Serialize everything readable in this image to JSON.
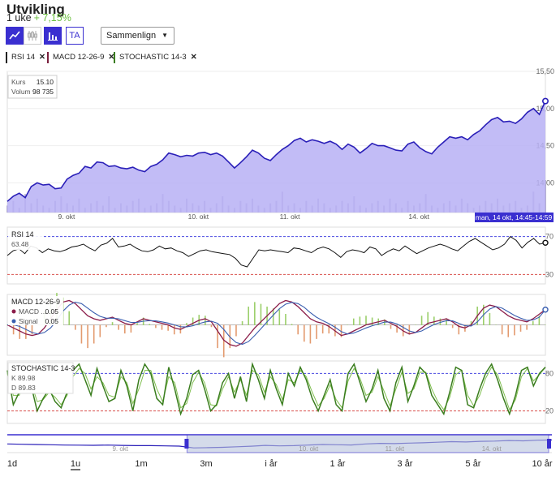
{
  "header": {
    "title": "Utvikling",
    "period": "1 uke",
    "change": "+ 7,15%"
  },
  "toolbar": {
    "buttons": [
      {
        "icon": "line-chart-icon",
        "active": true
      },
      {
        "icon": "candlestick-icon",
        "active": false
      },
      {
        "icon": "bar-chart-icon",
        "active": true
      },
      {
        "label": "TA",
        "active": false
      }
    ],
    "compare": "Sammenlign"
  },
  "indicators": [
    {
      "label": "RSI 14",
      "color": "#222222"
    },
    {
      "label": "MACD 12-26-9",
      "color": "#7a1f3d"
    },
    {
      "label": "STOCHASTIC 14-3",
      "color": "#3a7d1e"
    }
  ],
  "colors": {
    "accent": "#3a2fd0",
    "area": "#b7b0f5",
    "macd": "#8b1d4a",
    "signal": "#3a5fb0",
    "stochK": "#3a7d1e",
    "stochD": "#7fbf4f",
    "ref": "#d9534f"
  },
  "chart_data": [
    {
      "type": "area",
      "name": "Kurs",
      "x_ticks": [
        "9. okt",
        "10. okt",
        "11. okt",
        "14. okt"
      ],
      "y_ticks": [
        14.0,
        14.5,
        15.0,
        15.5
      ],
      "y_tick_labels": [
        "14,00",
        "14,50",
        "15,00",
        "15,50"
      ],
      "ylim": [
        13.6,
        15.5
      ],
      "values": [
        13.75,
        13.82,
        13.86,
        13.8,
        13.95,
        14.0,
        13.97,
        13.98,
        13.92,
        13.93,
        14.05,
        14.1,
        14.13,
        14.22,
        14.2,
        14.28,
        14.27,
        14.22,
        14.23,
        14.2,
        14.19,
        14.21,
        14.17,
        14.15,
        14.22,
        14.25,
        14.31,
        14.4,
        14.38,
        14.35,
        14.37,
        14.36,
        14.4,
        14.41,
        14.38,
        14.4,
        14.36,
        14.28,
        14.2,
        14.27,
        14.35,
        14.44,
        14.4,
        14.33,
        14.3,
        14.38,
        14.45,
        14.5,
        14.57,
        14.6,
        14.55,
        14.58,
        14.56,
        14.53,
        14.56,
        14.52,
        14.45,
        14.52,
        14.48,
        14.4,
        14.46,
        14.53,
        14.5,
        14.5,
        14.47,
        14.44,
        14.43,
        14.52,
        14.55,
        14.47,
        14.42,
        14.39,
        14.48,
        14.55,
        14.62,
        14.6,
        14.62,
        14.58,
        14.65,
        14.7,
        14.78,
        14.85,
        14.88,
        14.82,
        14.83,
        14.8,
        14.86,
        14.95,
        15.0,
        14.92,
        15.1
      ],
      "volume": [
        3,
        5,
        2,
        8,
        4,
        6,
        3,
        2,
        5,
        7,
        4,
        3,
        6,
        2,
        4,
        5,
        3,
        7,
        2,
        4,
        3,
        5,
        6,
        2,
        3,
        4,
        8,
        5,
        3,
        2,
        6,
        4,
        3,
        5,
        2,
        4,
        7,
        3,
        2,
        5,
        4,
        6,
        3,
        2,
        4,
        5,
        9,
        3,
        4,
        2,
        5,
        3,
        6,
        4,
        2,
        3,
        5,
        4,
        7,
        3,
        2,
        4,
        5,
        3,
        6,
        4,
        2,
        5,
        3,
        4,
        8,
        3,
        2,
        4,
        5,
        3,
        6,
        4,
        2,
        3,
        5,
        4,
        6,
        3,
        4,
        5,
        2,
        3,
        9,
        4,
        14
      ],
      "tooltip": {
        "kurs_label": "Kurs",
        "kurs": "15.10",
        "volum_label": "Volum",
        "volum": "98 735"
      },
      "crosshair_label": "man, 14 okt, 14:45-14:59"
    },
    {
      "type": "line",
      "name": "RSI 14",
      "value_label": "63.48",
      "ylim": [
        20,
        80
      ],
      "y_ticks": [
        30,
        70
      ],
      "reference_lines": [
        30,
        70
      ],
      "values": [
        50,
        55,
        57,
        52,
        60,
        58,
        53,
        57,
        55,
        54,
        56,
        59,
        60,
        62,
        58,
        55,
        61,
        63,
        68,
        59,
        60,
        62,
        58,
        55,
        54,
        56,
        60,
        57,
        58,
        55,
        53,
        49,
        52,
        55,
        56,
        54,
        53,
        52,
        51,
        47,
        40,
        38,
        47,
        56,
        55,
        56,
        55,
        54,
        53,
        58,
        57,
        55,
        53,
        57,
        59,
        57,
        53,
        48,
        54,
        56,
        55,
        53,
        59,
        57,
        50,
        54,
        57,
        55,
        60,
        56,
        52,
        55,
        58,
        60,
        62,
        60,
        57,
        55,
        60,
        65,
        68,
        64,
        60,
        56,
        58,
        62,
        70,
        66,
        58,
        64,
        68,
        62,
        63.48
      ]
    },
    {
      "type": "line",
      "name": "MACD 12-26-9",
      "series": [
        {
          "name": "MACD ...",
          "value": "0.05",
          "values": [
            0,
            -0.01,
            -0.02,
            -0.03,
            -0.035,
            -0.03,
            -0.01,
            0.02,
            0.05,
            0.075,
            0.08,
            0.07,
            0.05,
            0.03,
            0.02,
            0.015,
            0.02,
            0.025,
            0.015,
            0.005,
            0,
            0.01,
            0.02,
            0.015,
            0.01,
            0.005,
            0,
            -0.01,
            -0.015,
            -0.005,
            0.005,
            0.015,
            0.02,
            0.01,
            -0.02,
            -0.05,
            -0.065,
            -0.07,
            -0.06,
            -0.035,
            -0.01,
            0.01,
            0.03,
            0.05,
            0.07,
            0.08,
            0.075,
            0.06,
            0.04,
            0.02,
            0.01,
            0.005,
            -0.005,
            -0.02,
            -0.035,
            -0.03,
            -0.02,
            -0.01,
            0,
            0.005,
            0.01,
            0.015,
            0.005,
            -0.005,
            -0.02,
            -0.03,
            -0.025,
            -0.01,
            0.005,
            0.01,
            0.015,
            0.02,
            0.01,
            -0.005,
            -0.01,
            0,
            0.03,
            0.055,
            0.065,
            0.06,
            0.045,
            0.03,
            0.02,
            0.015,
            0.01,
            0.02,
            0.035,
            0.05
          ]
        },
        {
          "name": "Signal",
          "value": "0.05",
          "values": [
            0,
            0,
            -0.005,
            -0.015,
            -0.025,
            -0.03,
            -0.025,
            -0.01,
            0.015,
            0.045,
            0.065,
            0.075,
            0.07,
            0.055,
            0.04,
            0.028,
            0.022,
            0.022,
            0.02,
            0.014,
            0.008,
            0.008,
            0.012,
            0.014,
            0.013,
            0.01,
            0.006,
            0,
            -0.006,
            -0.007,
            -0.003,
            0.004,
            0.01,
            0.012,
            0.005,
            -0.015,
            -0.04,
            -0.058,
            -0.064,
            -0.055,
            -0.035,
            -0.013,
            0.01,
            0.032,
            0.053,
            0.068,
            0.074,
            0.07,
            0.058,
            0.04,
            0.025,
            0.014,
            0.004,
            -0.008,
            -0.022,
            -0.03,
            -0.027,
            -0.019,
            -0.01,
            -0.003,
            0.003,
            0.009,
            0.009,
            0.003,
            -0.008,
            -0.02,
            -0.025,
            -0.02,
            -0.009,
            0.001,
            0.008,
            0.014,
            0.013,
            0.005,
            -0.003,
            -0.004,
            0.01,
            0.033,
            0.052,
            0.06,
            0.055,
            0.043,
            0.031,
            0.022,
            0.015,
            0.016,
            0.025,
            0.05
          ]
        }
      ],
      "ylim": [
        -0.1,
        0.1
      ]
    },
    {
      "type": "line",
      "name": "STOCHASTIC 14-3",
      "series": [
        {
          "name": "K",
          "value": "89.98",
          "values": [
            85,
            30,
            50,
            90,
            60,
            20,
            40,
            55,
            35,
            25,
            50,
            85,
            95,
            70,
            45,
            88,
            60,
            35,
            40,
            85,
            60,
            20,
            70,
            95,
            80,
            40,
            30,
            90,
            55,
            15,
            40,
            78,
            85,
            55,
            20,
            30,
            65,
            80,
            40,
            75,
            35,
            95,
            70,
            40,
            85,
            55,
            30,
            80,
            60,
            90,
            70,
            40,
            20,
            45,
            70,
            30,
            20,
            80,
            95,
            65,
            35,
            55,
            85,
            40,
            20,
            65,
            90,
            35,
            60,
            90,
            80,
            45,
            30,
            15,
            50,
            90,
            85,
            30,
            25,
            55,
            80,
            95,
            70,
            40,
            15,
            45,
            85,
            90,
            60,
            80,
            89.98
          ]
        },
        {
          "name": "D",
          "value": "89.83",
          "values": [
            80,
            45,
            45,
            75,
            65,
            35,
            38,
            50,
            42,
            30,
            45,
            75,
            88,
            80,
            55,
            75,
            65,
            45,
            42,
            75,
            65,
            32,
            55,
            85,
            85,
            55,
            35,
            75,
            65,
            25,
            32,
            65,
            82,
            65,
            30,
            28,
            55,
            75,
            50,
            70,
            45,
            85,
            78,
            50,
            75,
            62,
            38,
            70,
            65,
            85,
            75,
            50,
            28,
            40,
            62,
            38,
            25,
            68,
            88,
            72,
            45,
            50,
            75,
            52,
            28,
            55,
            82,
            48,
            55,
            82,
            82,
            55,
            35,
            22,
            42,
            78,
            85,
            45,
            28,
            45,
            72,
            90,
            78,
            50,
            22,
            38,
            75,
            88,
            68,
            78,
            89.83
          ]
        }
      ],
      "ylim": [
        0,
        100
      ],
      "y_ticks": [
        20,
        80
      ],
      "reference_lines": [
        20,
        80
      ]
    }
  ],
  "navigator": {
    "labels": [
      "9. okt",
      "10. okt",
      "11. okt",
      "14. okt"
    ],
    "values": [
      0.55,
      0.52,
      0.5,
      0.48,
      0.45,
      0.44,
      0.43,
      0.45,
      0.42,
      0.4,
      0.4,
      0.38,
      0.36,
      0.2,
      0.22,
      0.25,
      0.3,
      0.35,
      0.42,
      0.38,
      0.4,
      0.45,
      0.5,
      0.48,
      0.46,
      0.55,
      0.6,
      0.58,
      0.62,
      0.65,
      0.7,
      0.75,
      0.72,
      0.78,
      0.8,
      0.85,
      0.82,
      0.88,
      0.9
    ],
    "selection": [
      0.33,
      1.0
    ]
  },
  "ranges": {
    "items": [
      "1d",
      "1u",
      "1m",
      "3m",
      "i år",
      "1 år",
      "3 år",
      "5 år",
      "10 år"
    ],
    "active": "1u"
  }
}
